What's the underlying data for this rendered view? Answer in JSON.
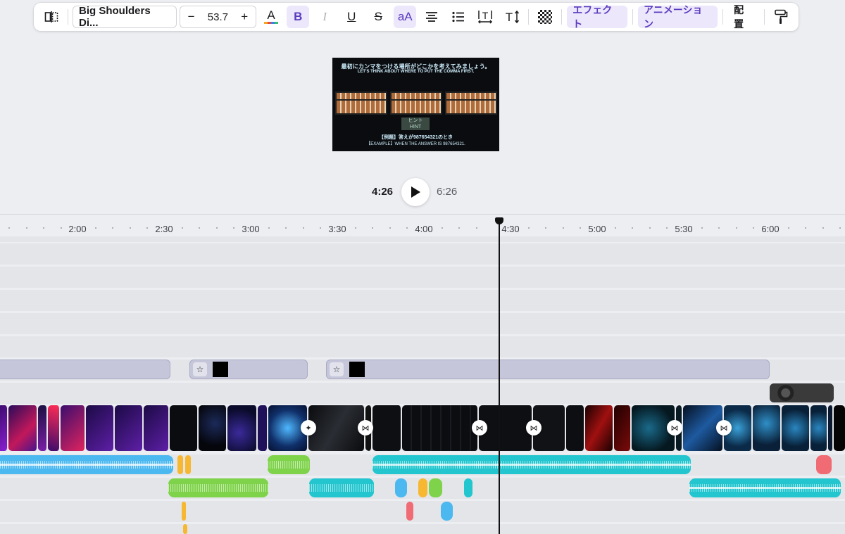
{
  "toolbar": {
    "font_name": "Big Shoulders Di...",
    "font_size": "53.7",
    "minus": "−",
    "plus": "+",
    "effects_label": "エフェクト",
    "animation_label": "アニメーション",
    "position_label": "配置",
    "case_label": "aA",
    "bold_label": "B",
    "italic_label": "I",
    "underline_label": "U",
    "strike_label": "S"
  },
  "preview": {
    "line1": "最初にカンマをつける場所がどこかを考えてみましょう。",
    "line2": "LET'S THINK ABOUT WHERE TO PUT THE COMMA FIRST.",
    "hint_jp": "ヒント",
    "hint_en": "HINT",
    "example_jp": "【例題】答えが987654321のとき",
    "example_en": "【EXAMPLE】WHEN THE ANSWER IS 987654321."
  },
  "playback": {
    "current_time": "4:26",
    "total_time": "6:26"
  },
  "timeline": {
    "ticks": [
      "2:00",
      "2:30",
      "3:00",
      "3:30",
      "4:00",
      "4:30",
      "5:00",
      "5:30",
      "6:00"
    ]
  },
  "colors": {
    "accent": "#5a3bbf",
    "accent_bg": "#ece7fb",
    "audio_blue": "#4bb8f0",
    "audio_green": "#7fd34b",
    "audio_cyan": "#23c6cf",
    "audio_yellow": "#f7b731",
    "audio_red": "#f06b73"
  }
}
